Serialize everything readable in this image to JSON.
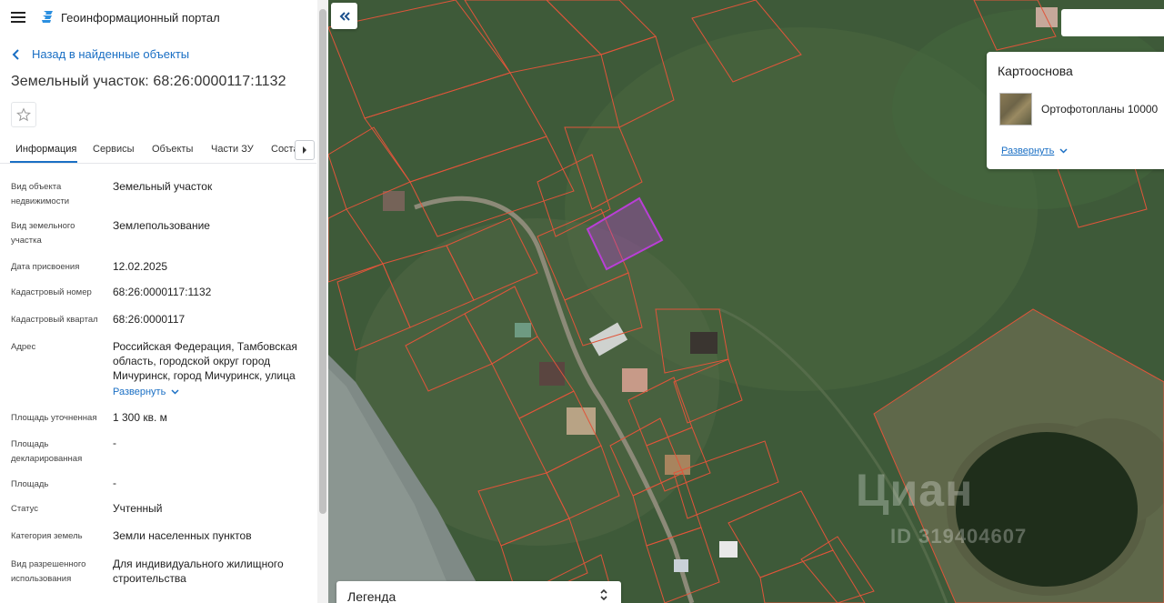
{
  "header": {
    "portal_title": "Геоинформационный портал"
  },
  "navigation": {
    "back_label": "Назад в найденные объекты"
  },
  "object": {
    "title": "Земельный участок: 68:26:0000117:1132"
  },
  "tabs": [
    {
      "label": "Информация",
      "active": true
    },
    {
      "label": "Сервисы"
    },
    {
      "label": "Объекты"
    },
    {
      "label": "Части ЗУ"
    },
    {
      "label": "Состав"
    }
  ],
  "properties": [
    {
      "label": "Вид объекта недвижимости",
      "value": "Земельный участок"
    },
    {
      "label": "Вид земельного участка",
      "value": "Землепользование"
    },
    {
      "label": "Дата присвоения",
      "value": "12.02.2025"
    },
    {
      "label": "Кадастровый номер",
      "value": "68:26:0000117:1132"
    },
    {
      "label": "Кадастровый квартал",
      "value": "68:26:0000117"
    },
    {
      "label": "Адрес",
      "value": "Российская Федерация, Тамбовская область, городской округ город Мичуринск, город Мичуринск, улица"
    },
    {
      "label": "Площадь уточненная",
      "value": "1 300 кв. м"
    },
    {
      "label": "Площадь декларированная",
      "value": "-"
    },
    {
      "label": "Площадь",
      "value": "-"
    },
    {
      "label": "Статус",
      "value": "Учтенный"
    },
    {
      "label": "Категория земель",
      "value": "Земли населенных пунктов"
    },
    {
      "label": "Вид разрешенного использования",
      "value": "Для индивидуального жилищного строительства"
    }
  ],
  "address_expand_label": "Развернуть",
  "map": {
    "basemap": {
      "title": "Картооснова",
      "option_label": "Ортофотопланы 10000",
      "expand_label": "Развернуть"
    },
    "legend_label": "Легенда",
    "watermark": "Циан",
    "watermark_id": "ID 319404607",
    "colors": {
      "parcel_outline": "#e0553a",
      "selected_parcel": "#b93fd6",
      "terrain": "#3f5a3a"
    }
  }
}
